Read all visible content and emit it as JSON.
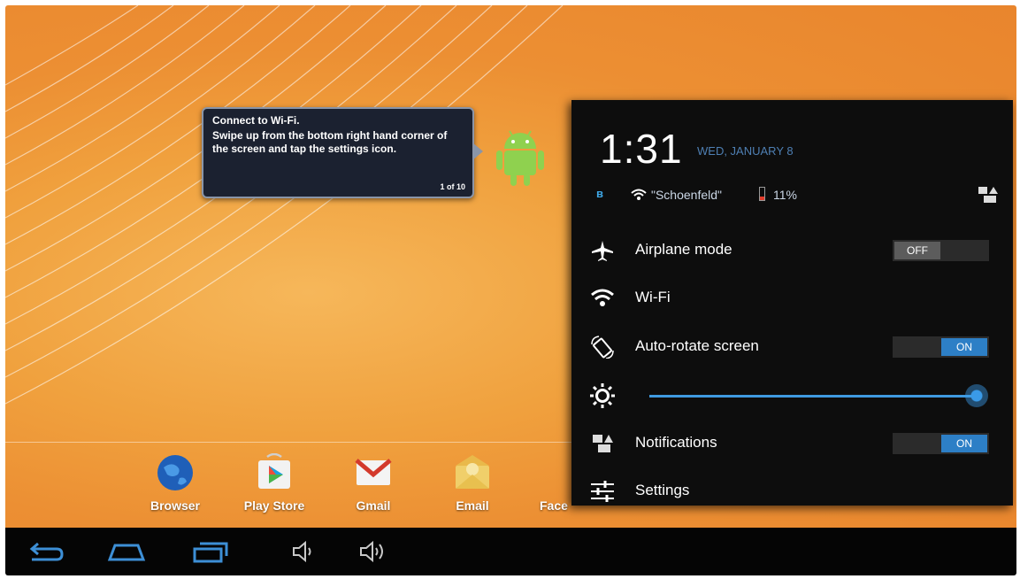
{
  "tooltip": {
    "title": "Connect to Wi-Fi.",
    "body": "Swipe up from the bottom right hand corner of the screen and tap the settings icon.",
    "page": "1 of 10"
  },
  "dock": {
    "apps": [
      {
        "label": "Browser",
        "icon": "globe-icon"
      },
      {
        "label": "Play Store",
        "icon": "play-store-icon"
      },
      {
        "label": "Gmail",
        "icon": "gmail-icon"
      },
      {
        "label": "Email",
        "icon": "email-icon"
      },
      {
        "label": "Face",
        "icon": "facebook-icon"
      }
    ]
  },
  "navbar": {
    "buttons": [
      "back-icon",
      "home-icon",
      "recent-apps-icon",
      "volume-down-icon",
      "volume-up-icon"
    ]
  },
  "panel": {
    "time": "1:31",
    "date": "WED, JANUARY 8",
    "bluetooth_icon": "ʙ",
    "ssid": "\"Schoenfeld\"",
    "battery": "11%",
    "rows": {
      "airplane": {
        "label": "Airplane mode",
        "state": "OFF"
      },
      "wifi": {
        "label": "Wi-Fi"
      },
      "rotate": {
        "label": "Auto-rotate screen",
        "state": "ON"
      },
      "notifications": {
        "label": "Notifications",
        "state": "ON"
      },
      "settings": {
        "label": "Settings"
      }
    },
    "brightness_level": 1.0
  },
  "colors": {
    "accent": "#2d7fc6",
    "wallpaper": "#ec8f33",
    "panel_bg": "#0d0d0d"
  }
}
